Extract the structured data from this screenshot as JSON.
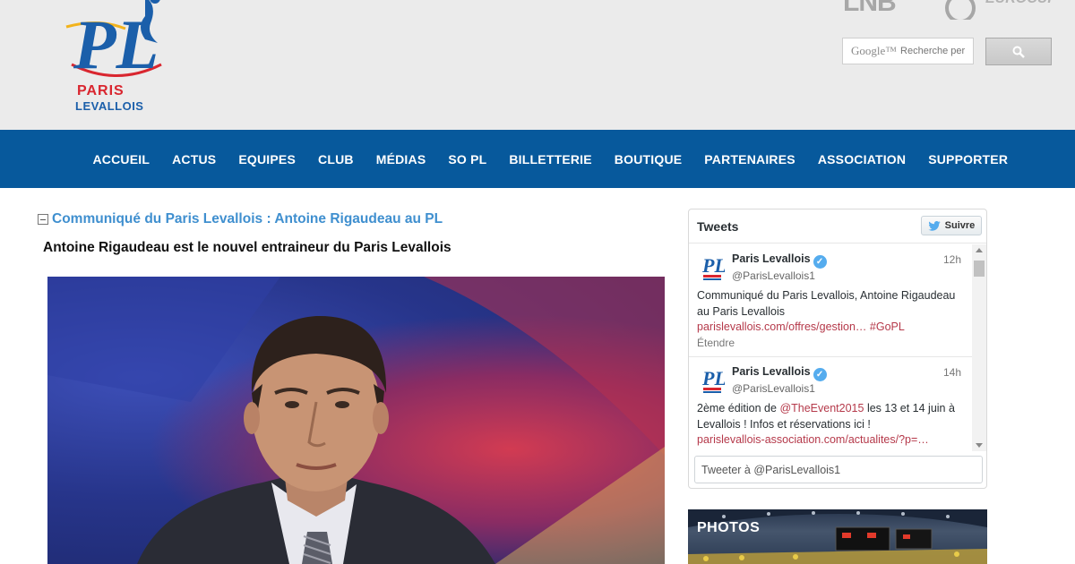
{
  "logo": {
    "line1": "PARIS",
    "line2": "LEVALLOIS",
    "monogram": "PL"
  },
  "partners": {
    "lnb": "LNB",
    "eurocup": "EUROCUP"
  },
  "search": {
    "brand": "Google™",
    "placeholder": "Recherche per",
    "icon": "search-icon"
  },
  "nav": {
    "items": [
      "ACCUEIL",
      "ACTUS",
      "EQUIPES",
      "CLUB",
      "MÉDIAS",
      "SO PL",
      "BILLETTERIE",
      "BOUTIQUE",
      "PARTENAIRES",
      "ASSOCIATION",
      "SUPPORTER"
    ]
  },
  "article": {
    "title": "Communiqué du Paris Levallois : Antoine Rigaudeau au PL",
    "subtitle": "Antoine Rigaudeau est le nouvel entraineur du Paris Levallois"
  },
  "twitter": {
    "header": "Tweets",
    "follow_label": "Suivre",
    "tweets": [
      {
        "name": "Paris Levallois",
        "handle": "@ParisLevallois1",
        "time": "12h",
        "text": "Communiqué du Paris Levallois, Antoine Rigaudeau au Paris Levallois",
        "link": "parislevallois.com/offres/gestion…",
        "hashtag": "#GoPL",
        "expand": "Étendre"
      },
      {
        "name": "Paris Levallois",
        "handle": "@ParisLevallois1",
        "time": "14h",
        "text_before": "2ème édition de",
        "mention": "@TheEvent2015",
        "text_after": "les 13 et 14 juin à Levallois ! Infos et réservations ici !",
        "link": "parislevallois-association.com/actualites/?p=…"
      }
    ],
    "compose_placeholder": "Tweeter à @ParisLevallois1"
  },
  "photos": {
    "label": "PHOTOS"
  },
  "colors": {
    "nav_bg": "#07599c",
    "title_blue": "#3f8fcf",
    "link_red": "#b5394a",
    "header_bg": "#ebebeb"
  }
}
